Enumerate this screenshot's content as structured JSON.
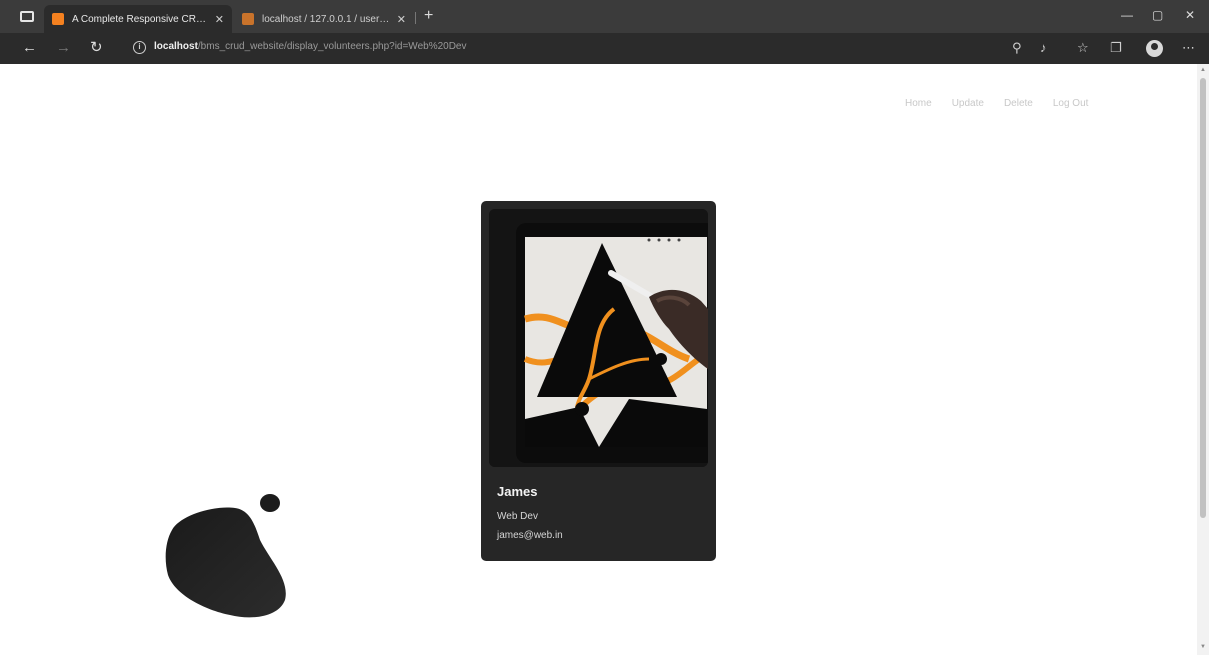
{
  "browser": {
    "tabs": [
      {
        "label": "A Complete Responsive CRUD",
        "active": true
      },
      {
        "label": "localhost / 127.0.0.1 / user_data",
        "active": false
      }
    ],
    "new_tab": "+",
    "window_controls": {
      "minimize": "—",
      "maximize": "▢",
      "close": "✕"
    },
    "address": {
      "host": "localhost",
      "path": "/bms_crud_website/display_volunteers.php?id=Web%20Dev"
    }
  },
  "site_nav": {
    "items": [
      "Home",
      "Update",
      "Delete",
      "Log Out"
    ]
  },
  "card": {
    "name": "James",
    "role": "Web Dev",
    "email": "james@web.in"
  },
  "colors": {
    "accent_orange": "#f0901e",
    "card_bg": "#262626"
  }
}
